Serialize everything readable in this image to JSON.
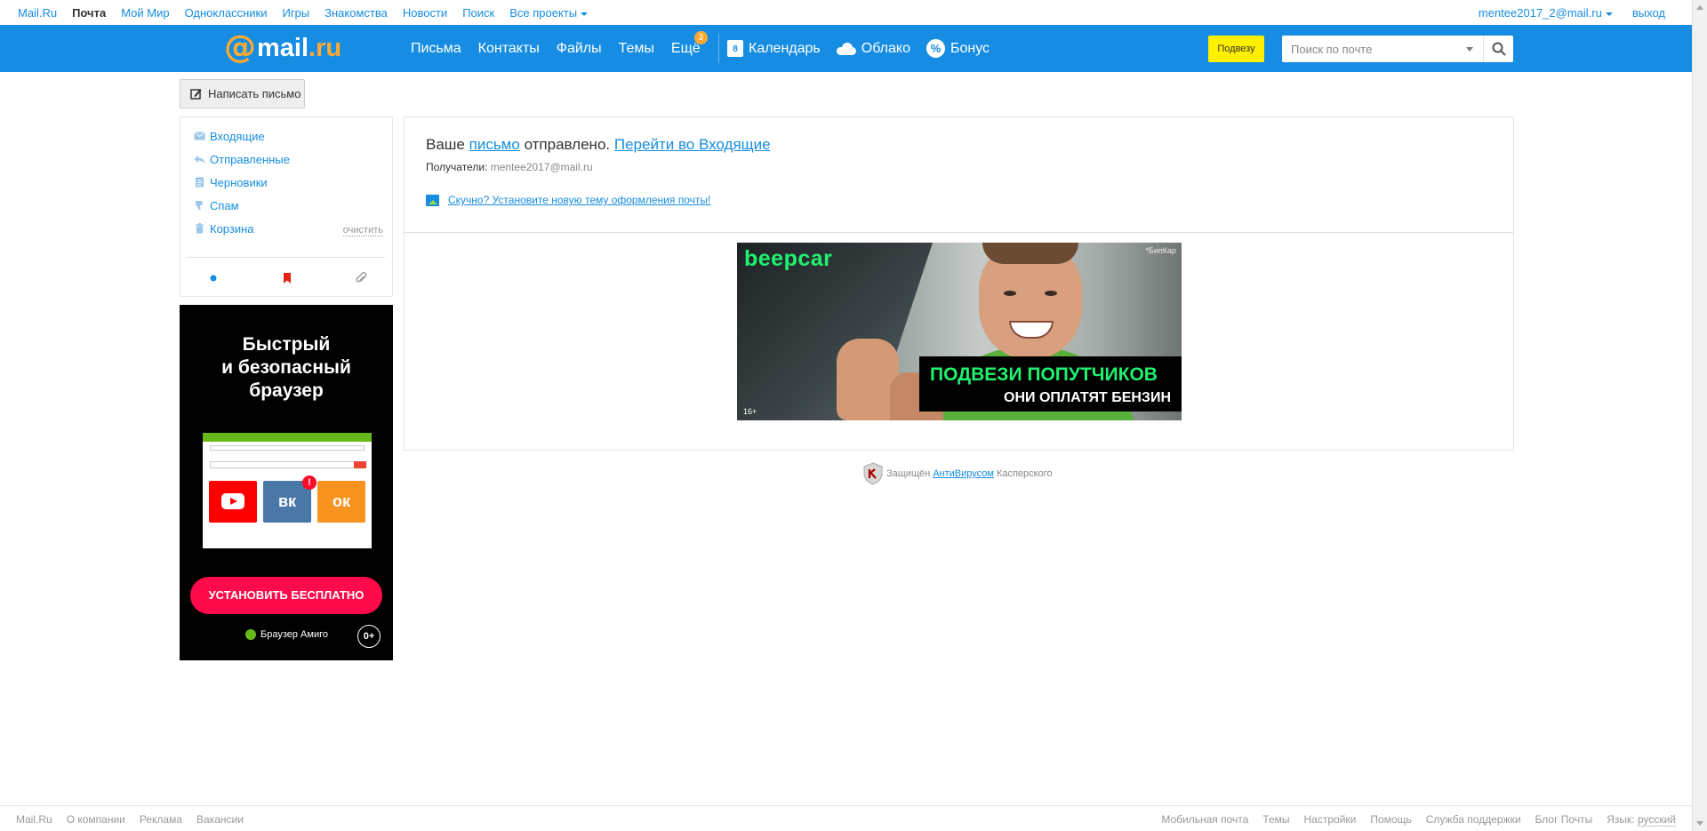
{
  "portal": {
    "links": [
      "Mail.Ru",
      "Почта",
      "Мой Мир",
      "Одноклассники",
      "Игры",
      "Знакомства",
      "Новости",
      "Поиск",
      "Все проекты"
    ],
    "user": "mentee2017_2@mail.ru",
    "logout": "выход"
  },
  "header": {
    "logo": {
      "at": "@",
      "word": "mail",
      "dot": ".",
      "ru": "ru"
    },
    "nav": [
      "Письма",
      "Контакты",
      "Файлы",
      "Темы",
      "Ещё"
    ],
    "more_badge": "3",
    "calendar_day": "8",
    "calendar": "Календарь",
    "cloud": "Облако",
    "bonus": "Бонус",
    "bonus_icon": "%",
    "ride_button": "Подвезу",
    "search_placeholder": "Поиск по почте"
  },
  "compose_label": "Написать письмо",
  "folders": {
    "inbox": "Входящие",
    "sent": "Отправленные",
    "drafts": "Черновики",
    "spam": "Спам",
    "trash": "Корзина",
    "clean": "очистить"
  },
  "amigo_ad": {
    "headline_1": "Быстрый",
    "headline_2": "и безопасный",
    "headline_3": "браузер",
    "vk": "вк",
    "ok": "ок",
    "notif": "!",
    "cta": "УСТАНОВИТЬ БЕСПЛАТНО",
    "brand": "Браузер Амиго",
    "age": "0+"
  },
  "result": {
    "prefix": "Ваше",
    "letter_link": "письмо",
    "middle": "отправлено.",
    "inbox_link": "Перейти во Входящие",
    "recipients_label": "Получатели:",
    "recipients": "mentee2017@mail.ru",
    "theme_link": "Скучно? Установите новую тему оформления почты!"
  },
  "banner": {
    "logo": "beepcar",
    "mark": "*БипКар",
    "line1": "ПОДВЕЗИ ПОПУТЧИКОВ",
    "line2": "ОНИ ОПЛАТЯТ БЕНЗИН",
    "age": "16+"
  },
  "kaspersky": {
    "prefix": "Защищён",
    "link": "АнтиВирусом",
    "suffix": "Касперского"
  },
  "footer": {
    "left": [
      "Mail.Ru",
      "О компании",
      "Реклама",
      "Вакансии"
    ],
    "right": [
      "Мобильная почта",
      "Темы",
      "Настройки",
      "Помощь",
      "Служба поддержки",
      "Блог Почты"
    ],
    "lang_label": "Язык:",
    "lang": "русский"
  }
}
